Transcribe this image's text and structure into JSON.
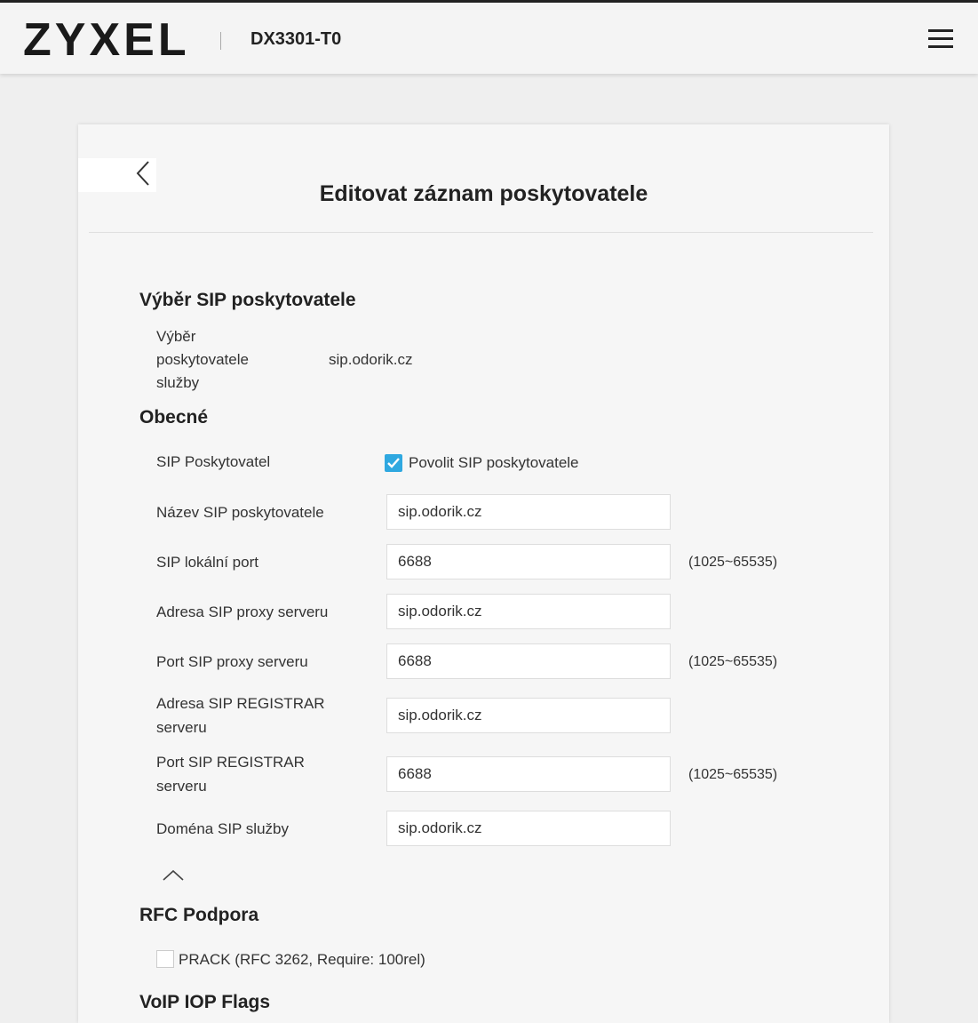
{
  "header": {
    "logo_text": "ZYXEL",
    "model": "DX3301-T0"
  },
  "page": {
    "title": "Editovat záznam poskytovatele"
  },
  "sections": {
    "provider_selection": {
      "heading": "Výběr SIP poskytovatele",
      "label_line1": "Výběr",
      "label_line2": "poskytovatele",
      "label_line3": "služby",
      "value": "sip.odorik.cz"
    },
    "general": {
      "heading": "Obecné",
      "sip_provider_label": "SIP Poskytovatel",
      "enable_checkbox_label": "Povolit SIP poskytovatele",
      "enable_checked": true,
      "fields": [
        {
          "label": "Název SIP poskytovatele",
          "value": "sip.odorik.cz",
          "range": ""
        },
        {
          "label": "SIP lokální port",
          "value": "6688",
          "range": "(1025~65535)"
        },
        {
          "label": "Adresa SIP proxy serveru",
          "value": "sip.odorik.cz",
          "range": ""
        },
        {
          "label": "Port SIP proxy serveru",
          "value": "6688",
          "range": "(1025~65535)"
        },
        {
          "label_line1": "Adresa SIP REGISTRAR",
          "label_line2": "serveru",
          "value": "sip.odorik.cz",
          "range": ""
        },
        {
          "label_line1": "Port SIP REGISTRAR",
          "label_line2": "serveru",
          "value": "6688",
          "range": "(1025~65535)"
        },
        {
          "label": "Doména SIP služby",
          "value": "sip.odorik.cz",
          "range": ""
        }
      ]
    },
    "rfc": {
      "heading": "RFC Podpora",
      "prack_label": "PRACK (RFC 3262, Require: 100rel)",
      "prack_checked": false
    },
    "voip_iop": {
      "heading": "VoIP IOP Flags"
    }
  },
  "colors": {
    "accent": "#2fa8e0"
  }
}
